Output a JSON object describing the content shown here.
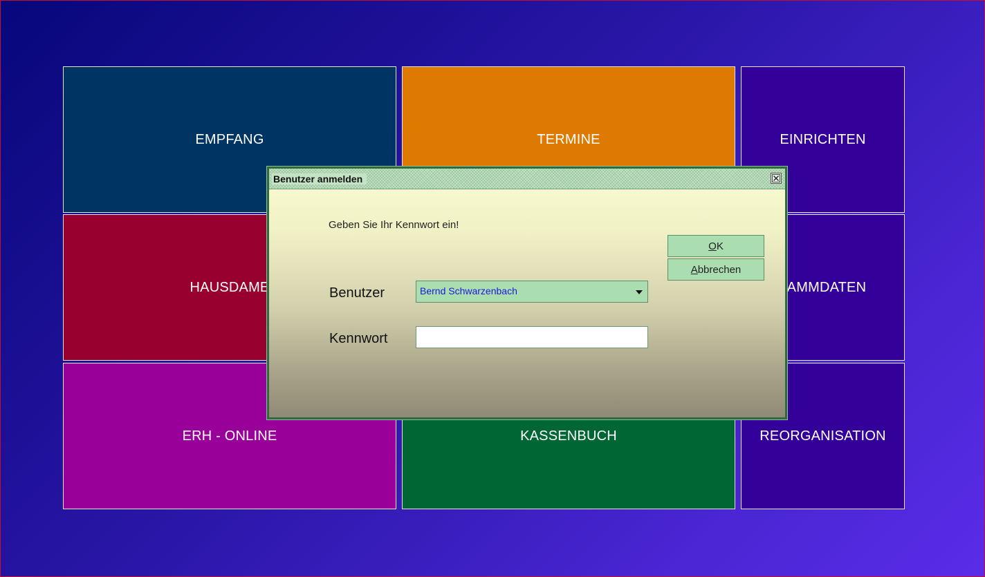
{
  "tiles": {
    "empfang": "EMPFANG",
    "termine": "TERMINE",
    "einrichten": "EINRICHTEN",
    "hausdame": "HAUSDAME",
    "stammdaten": "TAMMDATEN",
    "erh_online": "ERH - ONLINE",
    "kassenbuch": "KASSENBUCH",
    "reorganisation": "REORGANISATION"
  },
  "dialog": {
    "title": "Benutzer anmelden",
    "prompt": "Geben Sie Ihr Kennwort ein!",
    "user_label": "Benutzer",
    "user_value": "Bernd Schwarzenbach",
    "password_label": "Kennwort",
    "password_value": "",
    "ok_mnemonic": "O",
    "ok_rest": "K",
    "cancel_mnemonic": "A",
    "cancel_rest": "bbrechen"
  },
  "icons": {
    "close": "close-icon",
    "dropdown": "chevron-down-icon"
  },
  "colors": {
    "empfang": "#003463",
    "termine": "#de7a02",
    "einrichten": "#330099",
    "hausdame": "#98002f",
    "erh_online": "#990099",
    "kassenbuch": "#006633",
    "dialog_accent": "#aadeb0"
  }
}
